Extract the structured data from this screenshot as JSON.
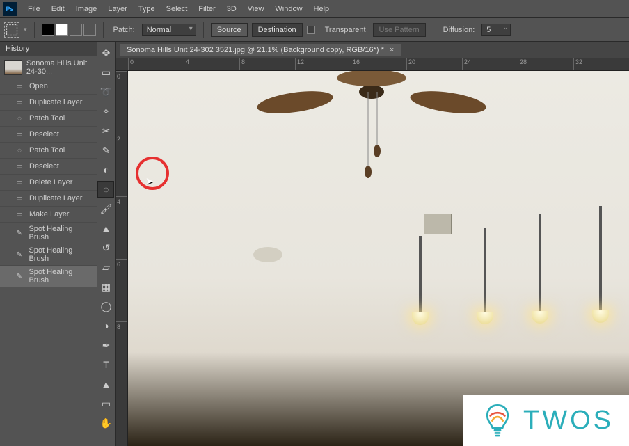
{
  "menu": {
    "items": [
      "File",
      "Edit",
      "Image",
      "Layer",
      "Type",
      "Select",
      "Filter",
      "3D",
      "View",
      "Window",
      "Help"
    ]
  },
  "options_bar": {
    "patch_label": "Patch:",
    "patch_mode": "Normal",
    "source_btn": "Source",
    "destination_btn": "Destination",
    "transparent_label": "Transparent",
    "use_pattern_btn": "Use Pattern",
    "diffusion_label": "Diffusion:",
    "diffusion_value": "5"
  },
  "history_panel": {
    "title": "History",
    "snapshot_name": "Sonoma Hills Unit 24-30...",
    "items": [
      {
        "icon": "open-icon",
        "label": "Open"
      },
      {
        "icon": "layer-icon",
        "label": "Duplicate Layer"
      },
      {
        "icon": "patch-icon",
        "label": "Patch Tool"
      },
      {
        "icon": "layer-icon",
        "label": "Deselect"
      },
      {
        "icon": "patch-icon",
        "label": "Patch Tool"
      },
      {
        "icon": "layer-icon",
        "label": "Deselect"
      },
      {
        "icon": "layer-icon",
        "label": "Delete Layer"
      },
      {
        "icon": "layer-icon",
        "label": "Duplicate Layer"
      },
      {
        "icon": "layer-icon",
        "label": "Make Layer"
      },
      {
        "icon": "brush-icon",
        "label": "Spot Healing Brush"
      },
      {
        "icon": "brush-icon",
        "label": "Spot Healing Brush"
      },
      {
        "icon": "brush-icon",
        "label": "Spot Healing Brush"
      }
    ],
    "selected_index": 11
  },
  "document": {
    "tab_title": "Sonoma Hills Unit 24-302 3521.jpg @ 21.1% (Background copy, RGB/16*) *"
  },
  "ruler": {
    "h": [
      "0",
      "4",
      "8",
      "12",
      "16",
      "20",
      "24",
      "28",
      "32"
    ],
    "v": [
      "0",
      "2",
      "4",
      "6",
      "8"
    ]
  },
  "tools": [
    "move-tool",
    "marquee-tool",
    "lasso-tool",
    "magic-wand-tool",
    "crop-tool",
    "eyedropper-tool",
    "spot-healing-tool",
    "patch-tool",
    "brush-tool",
    "clone-stamp-tool",
    "history-brush-tool",
    "eraser-tool",
    "gradient-tool",
    "blur-tool",
    "dodge-tool",
    "pen-tool",
    "type-tool",
    "path-selection-tool",
    "rectangle-tool",
    "hand-tool"
  ],
  "tools_selected": "patch-tool",
  "watermark": {
    "text": "TWOS"
  }
}
